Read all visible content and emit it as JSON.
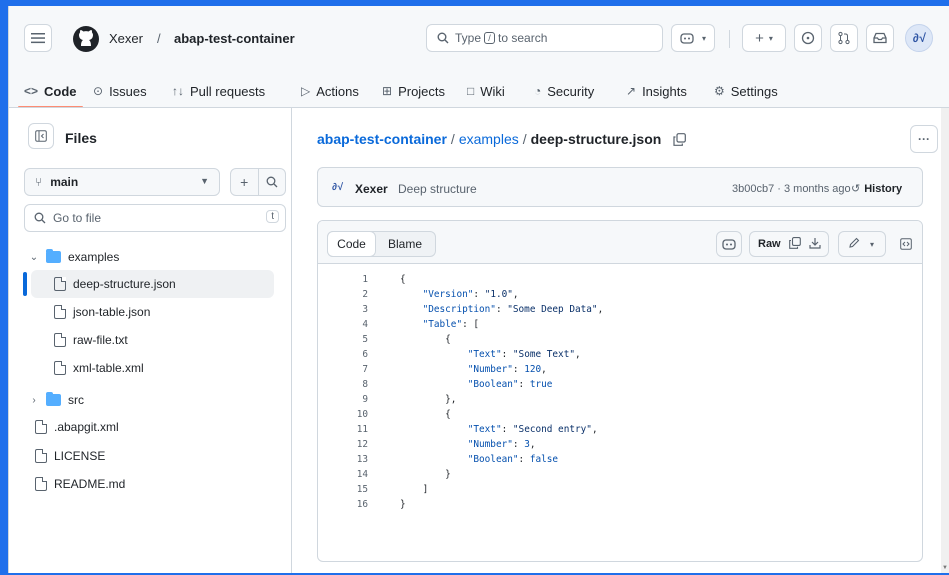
{
  "header": {
    "owner": "Xexer",
    "separator": "/",
    "repo": "abap-test-container",
    "search_prefix": "Type",
    "search_key": "/",
    "search_suffix": "to search",
    "avatar_text": "∂√"
  },
  "tabs": [
    {
      "icon": "<>",
      "label": "Code"
    },
    {
      "icon": "⊙",
      "label": "Issues"
    },
    {
      "icon": "↑↓",
      "label": "Pull requests"
    },
    {
      "icon": "▷",
      "label": "Actions"
    },
    {
      "icon": "⊞",
      "label": "Projects"
    },
    {
      "icon": "□",
      "label": "Wiki"
    },
    {
      "icon": "◔",
      "label": "Security"
    },
    {
      "icon": "↗",
      "label": "Insights"
    },
    {
      "icon": "⚙",
      "label": "Settings"
    }
  ],
  "sidebar": {
    "title": "Files",
    "branch": "main",
    "goto_placeholder": "Go to file",
    "goto_key": "t",
    "tree": [
      {
        "label": "examples",
        "type": "folder",
        "expanded": true
      },
      {
        "label": "deep-structure.json",
        "type": "file",
        "selected": true
      },
      {
        "label": "json-table.json",
        "type": "file"
      },
      {
        "label": "raw-file.txt",
        "type": "file"
      },
      {
        "label": "xml-table.xml",
        "type": "file"
      },
      {
        "label": "src",
        "type": "folder",
        "expanded": false
      },
      {
        "label": ".abapgit.xml",
        "type": "file"
      },
      {
        "label": "LICENSE",
        "type": "file"
      },
      {
        "label": "README.md",
        "type": "file"
      }
    ]
  },
  "main": {
    "path_repo": "abap-test-container",
    "path_sep": "/",
    "path_folder": "examples",
    "path_file": "deep-structure.json",
    "commit_author": "Xexer",
    "commit_message": "Deep structure",
    "commit_meta": "3b00cb7 · 3 months ago",
    "history_label": "History",
    "view_code": "Code",
    "view_blame": "Blame",
    "raw_label": "Raw"
  },
  "code_lines": [
    "{",
    "    \"Version\": \"1.0\",",
    "    \"Description\": \"Some Deep Data\",",
    "    \"Table\": [",
    "        {",
    "            \"Text\": \"Some Text\",",
    "            \"Number\": 120,",
    "            \"Boolean\": true",
    "        },",
    "        {",
    "            \"Text\": \"Second entry\",",
    "            \"Number\": 3,",
    "            \"Boolean\": false",
    "        }",
    "    ]",
    "}"
  ],
  "colors": {
    "accent": "#0969da",
    "tab_underline": "#fd8c73",
    "folder": "#54aeff"
  }
}
